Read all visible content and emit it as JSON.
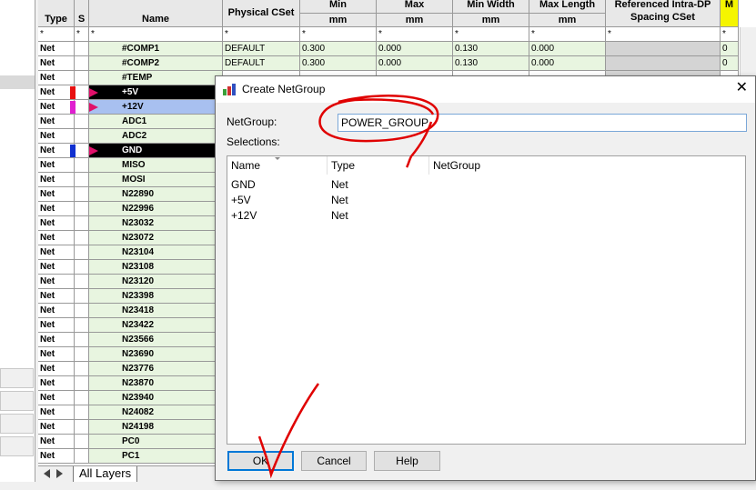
{
  "grid": {
    "headers": {
      "type": "Type",
      "s": "S",
      "name": "Name",
      "physical_cset": "Physical CSet",
      "min": "Min",
      "max": "Max",
      "min_width": "Min Width",
      "max_length": "Max Length",
      "unit": "mm",
      "ref_intra_dp_line1": "Referenced Intra-DP",
      "ref_intra_dp_line2": "Spacing CSet",
      "last_col": "M"
    },
    "filter": "*",
    "rows": [
      {
        "type": "Net",
        "name": "#COMP1",
        "cset": "DEFAULT",
        "min": "0.300",
        "max": "0.000",
        "minw": "0.130",
        "maxl": "0.000",
        "last": "0"
      },
      {
        "type": "Net",
        "name": "#COMP2",
        "cset": "DEFAULT",
        "min": "0.300",
        "max": "0.000",
        "minw": "0.130",
        "maxl": "0.000",
        "last": "0"
      },
      {
        "type": "Net",
        "name": "#TEMP"
      },
      {
        "type": "Net",
        "name": "+5V",
        "swatch": "#e81010"
      },
      {
        "type": "Net",
        "name": "+12V",
        "swatch": "#e020d0"
      },
      {
        "type": "Net",
        "name": "ADC1"
      },
      {
        "type": "Net",
        "name": "ADC2"
      },
      {
        "type": "Net",
        "name": "GND",
        "swatch": "#1030d0"
      },
      {
        "type": "Net",
        "name": "MISO"
      },
      {
        "type": "Net",
        "name": "MOSI"
      },
      {
        "type": "Net",
        "name": "N22890"
      },
      {
        "type": "Net",
        "name": "N22996"
      },
      {
        "type": "Net",
        "name": "N23032"
      },
      {
        "type": "Net",
        "name": "N23072"
      },
      {
        "type": "Net",
        "name": "N23104"
      },
      {
        "type": "Net",
        "name": "N23108"
      },
      {
        "type": "Net",
        "name": "N23120"
      },
      {
        "type": "Net",
        "name": "N23398"
      },
      {
        "type": "Net",
        "name": "N23418"
      },
      {
        "type": "Net",
        "name": "N23422"
      },
      {
        "type": "Net",
        "name": "N23566"
      },
      {
        "type": "Net",
        "name": "N23690"
      },
      {
        "type": "Net",
        "name": "N23776"
      },
      {
        "type": "Net",
        "name": "N23870"
      },
      {
        "type": "Net",
        "name": "N23940"
      },
      {
        "type": "Net",
        "name": "N24082"
      },
      {
        "type": "Net",
        "name": "N24198"
      },
      {
        "type": "Net",
        "name": "PC0"
      },
      {
        "type": "Net",
        "name": "PC1"
      }
    ]
  },
  "tabs": {
    "all_layers": "All Layers"
  },
  "dialog": {
    "title": "Create NetGroup",
    "netgroup_label": "NetGroup:",
    "netgroup_value": "POWER_GROUP",
    "selections_label": "Selections:",
    "columns": {
      "name": "Name",
      "type": "Type",
      "netgroup": "NetGroup"
    },
    "items": [
      {
        "name": "GND",
        "type": "Net"
      },
      {
        "name": "+5V",
        "type": "Net"
      },
      {
        "name": "+12V",
        "type": "Net"
      }
    ],
    "buttons": {
      "ok": "OK",
      "cancel": "Cancel",
      "help": "Help"
    }
  },
  "colors": {
    "row_green": "#e8f5e0",
    "selected_black": "#000000",
    "selected_blue": "#a8c0f0",
    "annotation_red": "#e00000",
    "marker_yellow": "#f5f500"
  }
}
